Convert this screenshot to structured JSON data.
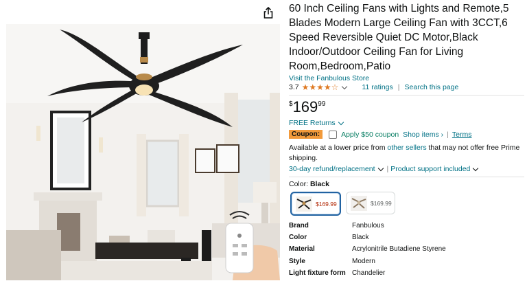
{
  "product": {
    "title": "60 Inch Ceiling Fans with Lights and Remote,5 Blades Modern Large Ceiling Fan with 3CCT,6 Speed Reversible Quiet DC Motor,Black Indoor/Outdoor Ceiling Fan for Living Room,Bedroom,Patio",
    "store_link": "Visit the Fanbulous Store",
    "rating": "3.7",
    "rating_value": 3.7,
    "ratings_count": "11 ratings",
    "search_page": "Search this page",
    "price_symbol": "$",
    "price_whole": "169",
    "price_fraction": "99",
    "returns": "FREE Returns",
    "coupon_label": "Coupon:",
    "coupon_text": "Apply $50 coupon",
    "shop_items": "Shop items ›",
    "coupon_sep": "|",
    "terms": "Terms",
    "availability_pre": "Available at a lower price from ",
    "availability_link": "other sellers",
    "availability_post": " that may not offer free Prime shipping.",
    "refund": "30-day refund/replacement",
    "refund_sep": "|",
    "support": "Product support included",
    "color_label": "Color:",
    "color_value": "Black",
    "swatches": [
      {
        "price": "$169.99",
        "price_color": "#b12704",
        "selected": true
      },
      {
        "price": "$169.99",
        "price_color": "#565959",
        "selected": false
      }
    ],
    "specs": [
      {
        "key": "Brand",
        "value": "Fanbulous"
      },
      {
        "key": "Color",
        "value": "Black"
      },
      {
        "key": "Material",
        "value": "Acrylonitrile Butadiene Styrene"
      },
      {
        "key": "Style",
        "value": "Modern"
      },
      {
        "key": "Light fixture form",
        "value": "Chandelier"
      }
    ]
  },
  "icons": {
    "share": "share-icon",
    "star": "star-icon",
    "chevron": "chevron-down-icon"
  },
  "colors": {
    "link": "#007185",
    "star": "#de7921",
    "coupon_badge": "#f29a3b",
    "apply": "#067d62",
    "price_deal": "#b12704",
    "selected_border": "#2162a1"
  }
}
